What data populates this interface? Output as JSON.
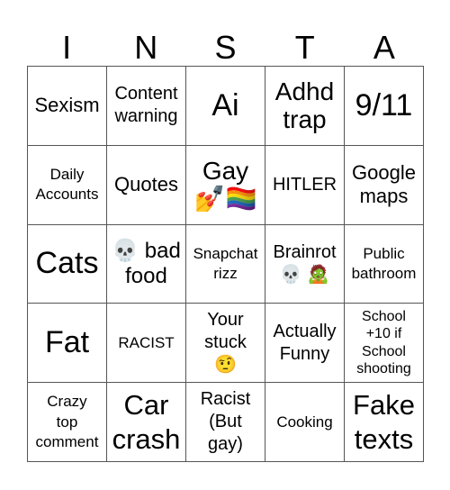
{
  "title_letters": [
    "I",
    "N",
    "S",
    "T",
    "A"
  ],
  "colors": {
    "background": "#ffffff",
    "grid_line": "#555555",
    "text": "#000000"
  },
  "cells": [
    [
      "Sexism",
      "Content\nwarning",
      "Ai",
      "Adhd\ntrap",
      "9/11"
    ],
    [
      "Daily\nAccounts",
      "Quotes",
      "Gay\n💅🏳️‍🌈",
      "HITLER",
      "Google\nmaps"
    ],
    [
      "Cats",
      "💀 bad\nfood",
      "Snapchat\nrizz",
      "Brainrot\n💀 🧟",
      "Public\nbathroom"
    ],
    [
      "Fat",
      "RACIST",
      "Your\nstuck\n🤨",
      "Actually\nFunny",
      "School\n+10 if\nSchool\nshooting"
    ],
    [
      "Crazy\ntop\ncomment",
      "Car\ncrash",
      "Racist\n(But\ngay)",
      "Cooking",
      "Fake\ntexts"
    ]
  ]
}
